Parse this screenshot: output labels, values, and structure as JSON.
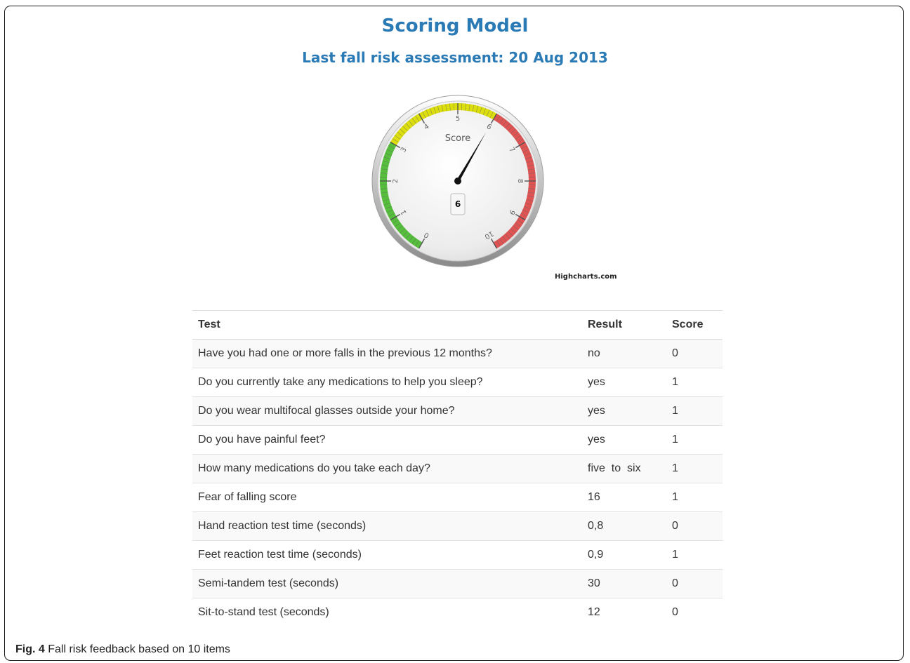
{
  "header": {
    "title": "Scoring Model",
    "subtitle": "Last fall risk assessment: 20 Aug 2013"
  },
  "gauge": {
    "label": "Score",
    "min": 0,
    "max": 10,
    "value": 6,
    "value_label": "6",
    "tick_labels": [
      "0",
      "1",
      "2",
      "3",
      "4",
      "5",
      "6",
      "7",
      "8",
      "9",
      "10"
    ],
    "bands": [
      {
        "from": 0,
        "to": 3,
        "color": "#55bf3b"
      },
      {
        "from": 3,
        "to": 6,
        "color": "#dddf0d"
      },
      {
        "from": 6,
        "to": 10,
        "color": "#df5353"
      }
    ],
    "credits": "Highcharts.com"
  },
  "table": {
    "headers": [
      "Test",
      "Result",
      "Score"
    ],
    "rows": [
      {
        "test": "Have you had one or more falls in the previous 12 months?",
        "result": "no",
        "score": "0"
      },
      {
        "test": "Do you currently take any medications to help you sleep?",
        "result": "yes",
        "score": "1"
      },
      {
        "test": "Do you wear multifocal glasses outside your home?",
        "result": "yes",
        "score": "1"
      },
      {
        "test": "Do you have painful feet?",
        "result": "yes",
        "score": "1"
      },
      {
        "test": "How many medications do you take each day?",
        "result": "five  to  six",
        "score": "1"
      },
      {
        "test": "Fear of falling score",
        "result": "16",
        "score": "1"
      },
      {
        "test": "Hand reaction test time (seconds)",
        "result": "0,8",
        "score": "0"
      },
      {
        "test": "Feet reaction test time (seconds)",
        "result": "0,9",
        "score": "1"
      },
      {
        "test": "Semi-tandem test (seconds)",
        "result": "30",
        "score": "0"
      },
      {
        "test": "Sit-to-stand test (seconds)",
        "result": "12",
        "score": "0"
      }
    ]
  },
  "caption": {
    "label": "Fig. 4",
    "text": "Fall risk feedback based on 10 items"
  }
}
